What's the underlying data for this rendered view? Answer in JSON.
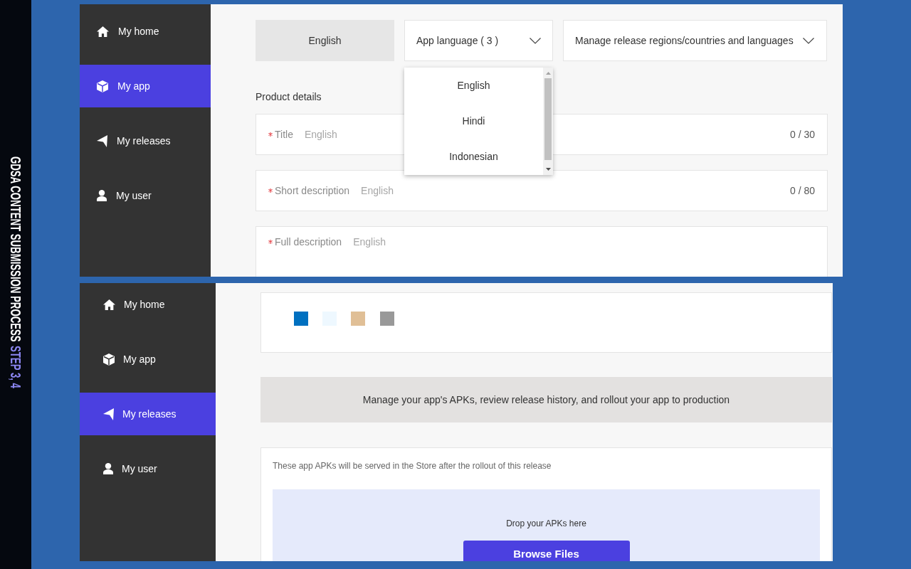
{
  "caption": {
    "title": "GDSA CONTENT SUBMISSION PROCESS",
    "step": "STEP 3, 4"
  },
  "top_screen": {
    "sidebar": {
      "items": [
        {
          "label": "My home",
          "selected": false
        },
        {
          "label": "My app",
          "selected": true
        },
        {
          "label": "My releases",
          "selected": false
        },
        {
          "label": "My user",
          "selected": false
        }
      ]
    },
    "language_bar": {
      "current_language": "English",
      "app_language": {
        "label": "App language ( 3 )",
        "expanded": true,
        "options": [
          {
            "label": "English"
          },
          {
            "label": "Hindi"
          },
          {
            "label": "Indonesian"
          }
        ]
      },
      "regions": {
        "label": "Manage release regions/countries and languages"
      }
    },
    "product_details": {
      "heading": "Product details",
      "fields": [
        {
          "kind": "single_line",
          "required": true,
          "label": "Title",
          "language": "English",
          "counter": "0 / 30"
        },
        {
          "kind": "single_line",
          "required": true,
          "label": "Short description",
          "language": "English",
          "counter": "0 / 80"
        },
        {
          "kind": "multi_line",
          "required": true,
          "label": "Full description",
          "language": "English"
        }
      ]
    }
  },
  "bottom_screen": {
    "sidebar": {
      "items": [
        {
          "label": "My home",
          "selected": false
        },
        {
          "label": "My app",
          "selected": false
        },
        {
          "label": "My releases",
          "selected": true
        },
        {
          "label": "My user",
          "selected": false
        }
      ]
    },
    "swatches": [
      {
        "color": "#0070c0"
      },
      {
        "color": "#eef8ff"
      },
      {
        "color": "#e0bf96"
      },
      {
        "color": "#999999"
      }
    ],
    "banner": "Manage your app's APKs, review release history, and rollout your app to production",
    "apk_card": {
      "note": "These app APKs will be served in the Store after the rollout of this release",
      "drop_zone": {
        "prompt": "Drop your APKs here",
        "button": "Browse Files"
      }
    }
  }
}
